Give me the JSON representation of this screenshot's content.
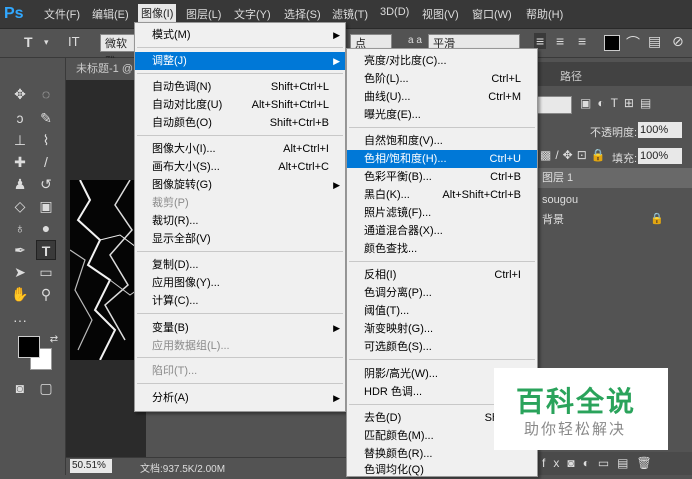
{
  "menubar": {
    "logo": "Ps",
    "items": [
      "文件(F)",
      "编辑(E)",
      "图像(I)",
      "图层(L)",
      "文字(Y)",
      "选择(S)",
      "滤镜(T)",
      "3D(D)",
      "视图(V)",
      "窗口(W)",
      "帮助(H)"
    ],
    "active_index": 2
  },
  "options": {
    "font_family": "微软雅",
    "font_size_unit": "点",
    "antialias_label": "a a",
    "antialias": "平滑"
  },
  "document": {
    "tab_title": "未标题-1 @",
    "zoom": "50.51%",
    "doc_info": "文档:937.5K/2.00M"
  },
  "panels": {
    "tab_paths": "路径",
    "opacity_label": "不透明度:",
    "opacity_value": "100%",
    "fill_label": "填充:",
    "fill_value": "100%",
    "layers": [
      "图层 1",
      "sougou",
      "背景"
    ]
  },
  "image_menu": {
    "items": [
      {
        "label": "模式(M)",
        "shortcut": "",
        "submenu": true,
        "disabled": false
      },
      {
        "label": "调整(J)",
        "shortcut": "",
        "submenu": true,
        "disabled": false,
        "highlighted": true
      },
      {
        "label": "自动色调(N)",
        "shortcut": "Shift+Ctrl+L"
      },
      {
        "label": "自动对比度(U)",
        "shortcut": "Alt+Shift+Ctrl+L"
      },
      {
        "label": "自动颜色(O)",
        "shortcut": "Shift+Ctrl+B"
      },
      {
        "label": "图像大小(I)...",
        "shortcut": "Alt+Ctrl+I"
      },
      {
        "label": "画布大小(S)...",
        "shortcut": "Alt+Ctrl+C"
      },
      {
        "label": "图像旋转(G)",
        "shortcut": "",
        "submenu": true
      },
      {
        "label": "裁剪(P)",
        "shortcut": "",
        "disabled": true
      },
      {
        "label": "裁切(R)...",
        "shortcut": ""
      },
      {
        "label": "显示全部(V)",
        "shortcut": ""
      },
      {
        "label": "复制(D)...",
        "shortcut": ""
      },
      {
        "label": "应用图像(Y)...",
        "shortcut": ""
      },
      {
        "label": "计算(C)...",
        "shortcut": ""
      },
      {
        "label": "变量(B)",
        "shortcut": "",
        "submenu": true
      },
      {
        "label": "应用数据组(L)...",
        "shortcut": "",
        "disabled": true
      },
      {
        "label": "陷印(T)...",
        "shortcut": "",
        "disabled": true
      },
      {
        "label": "分析(A)",
        "shortcut": "",
        "submenu": true
      }
    ]
  },
  "adjust_menu": {
    "items": [
      {
        "label": "亮度/对比度(C)...",
        "shortcut": ""
      },
      {
        "label": "色阶(L)...",
        "shortcut": "Ctrl+L"
      },
      {
        "label": "曲线(U)...",
        "shortcut": "Ctrl+M"
      },
      {
        "label": "曝光度(E)...",
        "shortcut": ""
      },
      {
        "label": "自然饱和度(V)...",
        "shortcut": ""
      },
      {
        "label": "色相/饱和度(H)...",
        "shortcut": "Ctrl+U",
        "highlighted": true
      },
      {
        "label": "色彩平衡(B)...",
        "shortcut": "Ctrl+B"
      },
      {
        "label": "黑白(K)...",
        "shortcut": "Alt+Shift+Ctrl+B"
      },
      {
        "label": "照片滤镜(F)...",
        "shortcut": ""
      },
      {
        "label": "通道混合器(X)...",
        "shortcut": ""
      },
      {
        "label": "颜色查找...",
        "shortcut": ""
      },
      {
        "label": "反相(I)",
        "shortcut": "Ctrl+I"
      },
      {
        "label": "色调分离(P)...",
        "shortcut": ""
      },
      {
        "label": "阈值(T)...",
        "shortcut": ""
      },
      {
        "label": "渐变映射(G)...",
        "shortcut": ""
      },
      {
        "label": "可选颜色(S)...",
        "shortcut": ""
      },
      {
        "label": "阴影/高光(W)...",
        "shortcut": ""
      },
      {
        "label": "HDR 色调...",
        "shortcut": ""
      },
      {
        "label": "去色(D)",
        "shortcut": "Shift+C"
      },
      {
        "label": "匹配颜色(M)...",
        "shortcut": ""
      },
      {
        "label": "替换颜色(R)...",
        "shortcut": ""
      },
      {
        "label": "色调均化(Q)",
        "shortcut": ""
      }
    ]
  },
  "watermark": {
    "title": "百科全说",
    "subtitle": "助你轻松解决"
  }
}
